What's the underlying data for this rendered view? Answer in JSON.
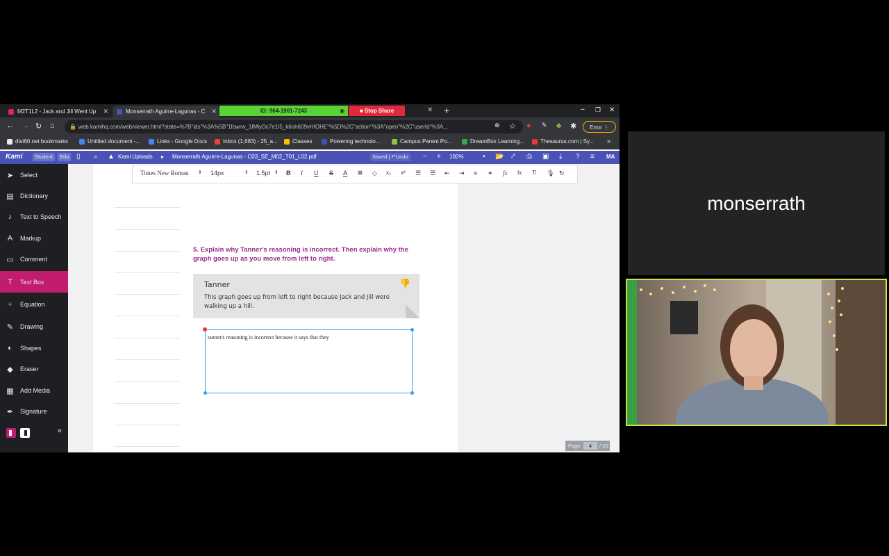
{
  "tabs": [
    {
      "title": "M2T1L2 - Jack and Jill Went Up",
      "active": false
    },
    {
      "title": "Monserrath Aguirre-Lagunas - C",
      "active": true
    }
  ],
  "zoom_bar": {
    "meeting_id": "ID: 964-1901-7243",
    "stop_share": "Stop Share"
  },
  "address": {
    "url": "web.kamihq.com/web/viewer.html?state=%7B\"ids\"%3A%5B\"1Ibwrw_1IMlyDc7e1I5_k6oh609vHIOHE\"%5D%2C\"action\"%3A\"open\"%2C\"userId\"%3A...",
    "error_label": "Error"
  },
  "bookmarks": [
    {
      "label": "dist60.net bookmarks",
      "color": "#e8eaed"
    },
    {
      "label": "Untitled document -...",
      "color": "#4285f4"
    },
    {
      "label": "Links - Google Docs",
      "color": "#4285f4"
    },
    {
      "label": "Inbox (1,683) - 25_a...",
      "color": "#ea4335"
    },
    {
      "label": "Classes",
      "color": "#fbbc04"
    },
    {
      "label": "Powering technolo...",
      "color": "#3f51b5"
    },
    {
      "label": "Campus Parent Po...",
      "color": "#8bc34a"
    },
    {
      "label": "DreamBox Learning...",
      "color": "#34a853"
    },
    {
      "label": "Thesaurus.com | Sy...",
      "color": "#e53935"
    }
  ],
  "kami": {
    "logo": "Kami",
    "badge_student": "Student",
    "badge_edu": "Edu",
    "folder": "Kami Uploads",
    "filename": "Monserrath Aguirre-Lagunas - C03_SE_M02_T01_L02.pdf",
    "saved": "Saved",
    "undo": "Undo",
    "zoom": "100%",
    "user_initials": "MA"
  },
  "sidebar": {
    "items": [
      {
        "label": "Select",
        "icon": "cursor-icon"
      },
      {
        "label": "Dictionary",
        "icon": "book-icon"
      },
      {
        "label": "Text to Speech",
        "icon": "speech-icon"
      },
      {
        "label": "Markup",
        "icon": "markup-icon"
      },
      {
        "label": "Comment",
        "icon": "comment-icon"
      },
      {
        "label": "Text Box",
        "icon": "textbox-icon"
      },
      {
        "label": "Equation",
        "icon": "equation-icon"
      },
      {
        "label": "Drawing",
        "icon": "brush-icon"
      },
      {
        "label": "Shapes",
        "icon": "shapes-icon"
      },
      {
        "label": "Eraser",
        "icon": "eraser-icon"
      },
      {
        "label": "Add Media",
        "icon": "media-icon"
      },
      {
        "label": "Signature",
        "icon": "signature-icon"
      }
    ],
    "font_size": "14",
    "swatches": [
      "#000000",
      "#d50000",
      "#ff9800"
    ]
  },
  "format_bar": {
    "font": "Times New Roman",
    "size": "14px",
    "line_height": "1.5pt"
  },
  "document": {
    "question_number": "5.",
    "question": "Explain why Tanner's reasoning is incorrect. Then explain why the graph goes up as you move from left to right.",
    "card_name": "Tanner",
    "card_text": "This graph goes up from left to right because Jack and Jill were walking up a hill.",
    "answer_text": "tanner's reasoning is incorrect because it says that they"
  },
  "page_indicator": {
    "label": "Page",
    "current": "4",
    "total": "/ 20"
  },
  "participant": {
    "name": "monserrath"
  }
}
